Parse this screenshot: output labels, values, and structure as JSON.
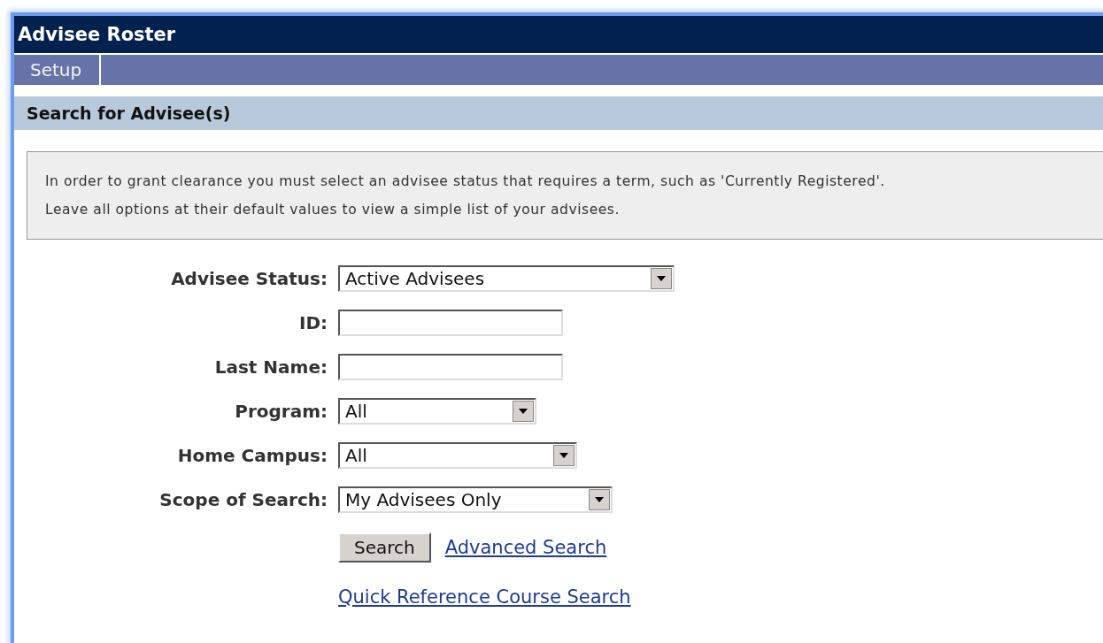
{
  "window": {
    "title": "Advisee Roster"
  },
  "menu": [
    {
      "label": "Setup"
    }
  ],
  "section": {
    "title": "Search for Advisee(s)"
  },
  "info": [
    "In order to grant clearance you must select an advisee status that requires a term, such as 'Currently Registered'.",
    "Leave all options at their default values to view a simple list of your advisees."
  ],
  "form": [
    {
      "label": "Advisee Status:",
      "kind": "select",
      "value": "Active Advisees"
    },
    {
      "label": "ID:",
      "kind": "text"
    },
    {
      "label": "Last Name:",
      "kind": "text"
    },
    {
      "label": "Program:",
      "kind": "select",
      "value": "All"
    },
    {
      "label": "Home Campus:",
      "kind": "select",
      "value": "All"
    },
    {
      "label": "Scope of Search:",
      "kind": "select",
      "value": "My Advisees Only"
    }
  ],
  "search_button": "Search",
  "links": [
    "Advanced Search",
    "Quick Reference Course Search"
  ]
}
